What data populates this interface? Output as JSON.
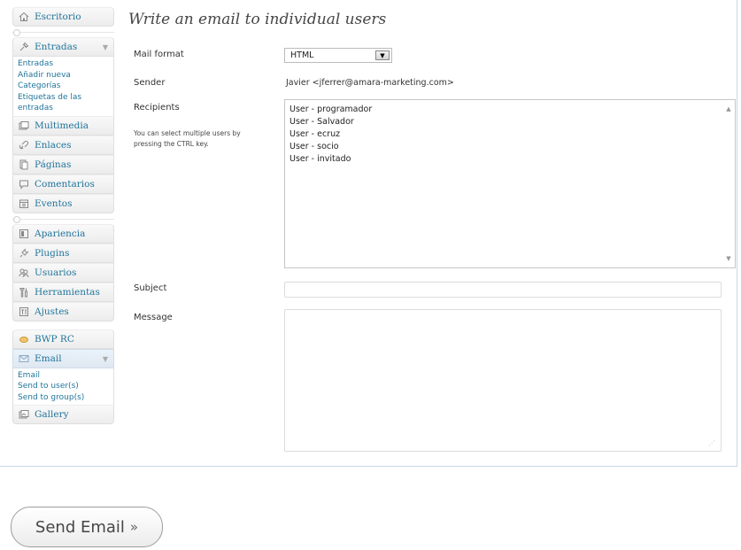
{
  "sidebar": {
    "escritorio": "Escritorio",
    "entradas": {
      "label": "Entradas",
      "sub": [
        "Entradas",
        "Añadir nueva",
        "Categorías",
        "Etiquetas de las",
        "entradas"
      ]
    },
    "multimedia": "Multimedia",
    "enlaces": "Enlaces",
    "paginas": "Páginas",
    "comentarios": "Comentarios",
    "eventos": "Eventos",
    "apariencia": "Apariencia",
    "plugins": "Plugins",
    "usuarios": "Usuarios",
    "herramientas": "Herramientas",
    "ajustes": "Ajustes",
    "bwp": "BWP RC",
    "email": {
      "label": "Email",
      "sub": [
        "Email",
        "Send to user(s)",
        "Send to group(s)"
      ]
    },
    "gallery": "Gallery"
  },
  "main": {
    "title": "Write an email to individual users",
    "mail_format_label": "Mail format",
    "mail_format_value": "HTML",
    "sender_label": "Sender",
    "sender_value": "Javier <jferrer@amara-marketing.com>",
    "recipients_label": "Recipients",
    "recipients_note": "You can select multiple users by pressing the CTRL key.",
    "recipients": [
      "User - programador",
      "User - Salvador",
      "User - ecruz",
      "User - socio",
      "User - invitado"
    ],
    "subject_label": "Subject",
    "message_label": "Message",
    "send_label": "Send Email",
    "send_suffix": "»"
  }
}
